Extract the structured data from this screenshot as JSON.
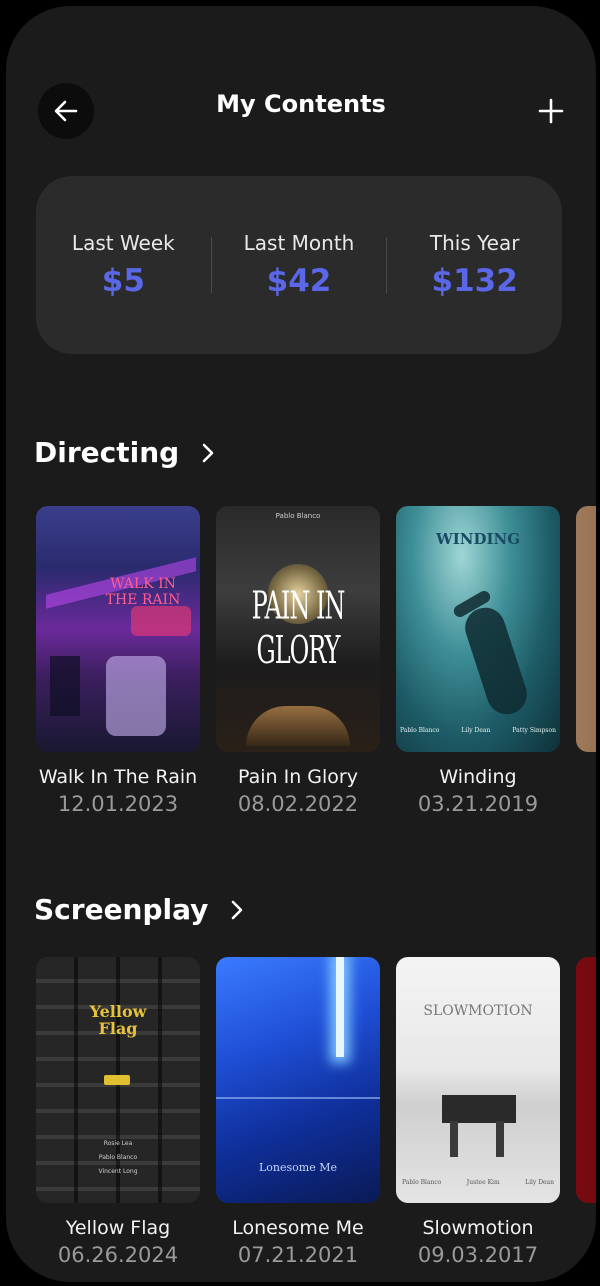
{
  "header": {
    "title": "My Contents",
    "back_icon": "arrow-left-icon",
    "add_icon": "plus-icon"
  },
  "stats": [
    {
      "label": "Last Week",
      "value": "$5"
    },
    {
      "label": "Last Month",
      "value": "$42"
    },
    {
      "label": "This Year",
      "value": "$132"
    }
  ],
  "colors": {
    "accent": "#5a67e6",
    "background": "#1b1b1b",
    "card": "#2b2b2b"
  },
  "sections": [
    {
      "title": "Directing",
      "items": [
        {
          "title": "Walk In The Rain",
          "date": "12.01.2023",
          "poster_title": "WALK IN THE RAIN"
        },
        {
          "title": "Pain In Glory",
          "date": "08.02.2022",
          "poster_title": "PAIN IN GLORY",
          "poster_credit": "Pablo Blanco"
        },
        {
          "title": "Winding",
          "date": "03.21.2019",
          "poster_title": "WINDING",
          "poster_credits": [
            "Pablo Blanco",
            "Lily Dean",
            "Patty Simpson"
          ]
        }
      ]
    },
    {
      "title": "Screenplay",
      "items": [
        {
          "title": "Yellow Flag",
          "date": "06.26.2024",
          "poster_title": "Yellow Flag",
          "poster_credits": [
            "Rosie Lea",
            "Pablo Blanco",
            "Vincent Long"
          ]
        },
        {
          "title": "Lonesome Me",
          "date": "07.21.2021",
          "poster_title": "Lonesome Me"
        },
        {
          "title": "Slowmotion",
          "date": "09.03.2017",
          "poster_title": "SLOWMOTION",
          "poster_credits": [
            "Pablo Blanco",
            "Justee Kim",
            "Lily Dean"
          ]
        }
      ]
    }
  ]
}
